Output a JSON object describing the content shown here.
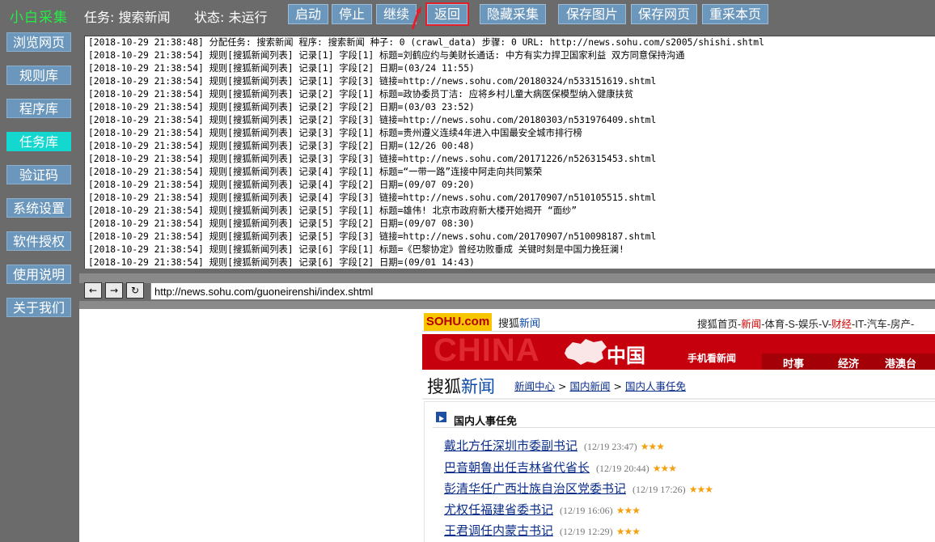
{
  "app": {
    "title": "小白采集",
    "task_label": "任务: 搜索新闻",
    "state_label": "状态: 未运行"
  },
  "toolbar": {
    "start": "启动",
    "stop": "停止",
    "continue": "继续",
    "back": "返回",
    "hide": "隐藏采集",
    "save_image": "保存图片",
    "save_page": "保存网页",
    "recollect": "重采本页",
    "annotation_color": "#e0202a"
  },
  "sidebar": {
    "items": [
      {
        "label": "浏览网页"
      },
      {
        "label": "规则库"
      },
      {
        "label": "程序库"
      },
      {
        "label": "任务库",
        "active": true
      },
      {
        "label": "验证码"
      },
      {
        "label": "系统设置"
      },
      {
        "label": "软件授权"
      },
      {
        "label": "使用说明"
      },
      {
        "label": "关于我们"
      }
    ]
  },
  "log": {
    "lines": [
      "[2018-10-29 21:38:48] 分配任务: 搜索新闻 程序: 搜索新闻 种子: 0 (crawl_data) 步骤: 0 URL: http://news.sohu.com/s2005/shishi.shtml",
      "[2018-10-29 21:38:54] 规则[搜狐新闻列表] 记录[1] 字段[1] 标题=刘鹤应约与美财长通话: 中方有实力捍卫国家利益 双方同意保持沟通",
      "[2018-10-29 21:38:54] 规则[搜狐新闻列表] 记录[1] 字段[2] 日期=(03/24 11:55)",
      "[2018-10-29 21:38:54] 规则[搜狐新闻列表] 记录[1] 字段[3] 链接=http://news.sohu.com/20180324/n533151619.shtml",
      "[2018-10-29 21:38:54] 规则[搜狐新闻列表] 记录[2] 字段[1] 标题=政协委员丁洁: 应将乡村儿童大病医保模型纳入健康扶贫",
      "[2018-10-29 21:38:54] 规则[搜狐新闻列表] 记录[2] 字段[2] 日期=(03/03 23:52)",
      "[2018-10-29 21:38:54] 规则[搜狐新闻列表] 记录[2] 字段[3] 链接=http://news.sohu.com/20180303/n531976409.shtml",
      "[2018-10-29 21:38:54] 规则[搜狐新闻列表] 记录[3] 字段[1] 标题=贵州遵义连续4年进入中国最安全城市排行榜",
      "[2018-10-29 21:38:54] 规则[搜狐新闻列表] 记录[3] 字段[2] 日期=(12/26 00:48)",
      "[2018-10-29 21:38:54] 规则[搜狐新闻列表] 记录[3] 字段[3] 链接=http://news.sohu.com/20171226/n526315453.shtml",
      "[2018-10-29 21:38:54] 规则[搜狐新闻列表] 记录[4] 字段[1] 标题=“一带一路”连接中阿走向共同繁荣",
      "[2018-10-29 21:38:54] 规则[搜狐新闻列表] 记录[4] 字段[2] 日期=(09/07 09:20)",
      "[2018-10-29 21:38:54] 规则[搜狐新闻列表] 记录[4] 字段[3] 链接=http://news.sohu.com/20170907/n510105515.shtml",
      "[2018-10-29 21:38:54] 规则[搜狐新闻列表] 记录[5] 字段[1] 标题=雄伟! 北京市政府新大楼开始揭开 “面纱”",
      "[2018-10-29 21:38:54] 规则[搜狐新闻列表] 记录[5] 字段[2] 日期=(09/07 08:30)",
      "[2018-10-29 21:38:54] 规则[搜狐新闻列表] 记录[5] 字段[3] 链接=http://news.sohu.com/20170907/n510098187.shtml",
      "[2018-10-29 21:38:54] 规则[搜狐新闻列表] 记录[6] 字段[1] 标题=《巴黎协定》曾经功败垂成 关键时刻是中国力挽狂澜!",
      "[2018-10-29 21:38:54] 规则[搜狐新闻列表] 记录[6] 字段[2] 日期=(09/01 14:43)"
    ]
  },
  "navbar": {
    "back": "←",
    "forward": "→",
    "refresh": "↻",
    "url": "http://news.sohu.com/guoneirenshi/index.shtml"
  },
  "browser": {
    "logo": "SOHU.com",
    "news_prefix": "搜狐",
    "news_suffix": "新闻",
    "top_links": [
      {
        "text": "搜狐首页",
        "red": false
      },
      {
        "text": "-",
        "red": false
      },
      {
        "text": "新闻",
        "red": true
      },
      {
        "text": "-体育-S-娱乐-V-",
        "red": false
      },
      {
        "text": "财经",
        "red": true
      },
      {
        "text": "-IT-汽车-房产-",
        "red": false
      }
    ],
    "banner": {
      "china": "CHINA",
      "cn": "中国",
      "mobile": "手机看新闻",
      "tabs": [
        "时事",
        "经济",
        "港澳台"
      ]
    },
    "header_prefix": "搜狐",
    "header_suffix": "新闻",
    "breadcrumb": [
      "新闻中心",
      "国内新闻",
      "国内人事任免"
    ],
    "breadcrumb_sep": ">",
    "section_title": "国内人事任免",
    "news": [
      {
        "title": "戴北方任深圳市委副书记",
        "time": "(12/19 23:47)",
        "stars": "★★★"
      },
      {
        "title": "巴音朝鲁出任吉林省代省长",
        "time": "(12/19 20:44)",
        "stars": "★★★"
      },
      {
        "title": "彭清华任广西壮族自治区党委书记",
        "time": "(12/19 17:26)",
        "stars": "★★★"
      },
      {
        "title": "尤权任福建省委书记",
        "time": "(12/19 16:06)",
        "stars": "★★★"
      },
      {
        "title": "王君调任内蒙古书记",
        "time": "(12/19 12:29)",
        "stars": "★★★"
      }
    ]
  }
}
